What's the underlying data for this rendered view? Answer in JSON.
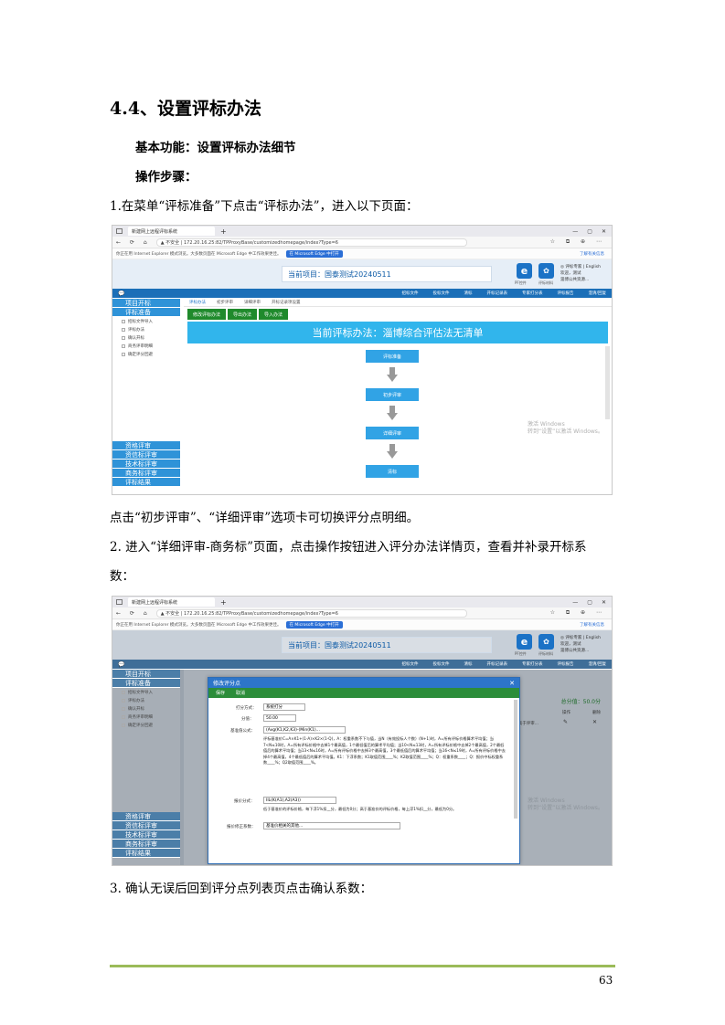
{
  "heading": "4.4、设置评标办法",
  "basic_func": "基本功能：设置评标办法细节",
  "steps_label": "操作步骤：",
  "step1": "1.在菜单“评标准备”下点击“评标办法”，进入以下页面：",
  "after_shot1": "点击“初步评审”、“详细评审”选项卡可切换评分点明细。",
  "step2_line1": "2.  进入“详细评审-商务标”页面，点击操作按钮进入评分办法详情页，查看并补录开标系",
  "step2_line2": "数：",
  "step3": "3.  确认无误后回到评分点列表页点击确认系数：",
  "page_number": "63",
  "browser": {
    "tab_title": "新建网上远程评标系统",
    "plus": "+",
    "win_buttons": [
      "—",
      "▢",
      "✕"
    ],
    "nav_glyphs": "← ⟳ ⌂",
    "url": "▲ 不安全 | 172.20.16.25:82/TPProxyBase/customizedhomepage/index?Type=6",
    "tool_glyphs": "☆ ⧉ ⊕ ⋯",
    "ie_notice": "你正在用 Internet Explorer 模式浏览。大多数页面在 Microsoft Edge 中工作效果更佳。",
    "ie_button": "在 Microsoft Edge 中打开",
    "ie_right": "了解有关信息"
  },
  "banner": {
    "project": "当前项目：国泰测试20240511",
    "e1": "e",
    "e1_caption": "PF控件",
    "e2": "✿",
    "e2_caption": "评标材料",
    "user_lines": [
      "◎ 评标专家 | English",
      "欢迎，测试",
      "淄博公共资源..."
    ]
  },
  "menu": {
    "bubble": "💬",
    "items": [
      "招标文件",
      "投标文件",
      "清标",
      "开标记录表",
      "专家打分表",
      "评标报告",
      "澄清/回复"
    ]
  },
  "sidebar": {
    "top": [
      "项目开标",
      "评标准备"
    ],
    "subs": [
      "招标文件导入",
      "评标办法",
      "确认开标",
      "商务评审明细",
      "确定评分回避"
    ],
    "bottom": [
      "资格评审",
      "资信标评审",
      "技术标评审",
      "商务标评审",
      "评标结果"
    ]
  },
  "shot1": {
    "tabs": [
      "评标办法",
      "初步评审",
      "详细评审",
      "开标记录项设置"
    ],
    "buttons": [
      "修改评标办法",
      "导出办法",
      "导入办法"
    ],
    "title": "当前评标办法：淄博综合评估法无清单",
    "flow": [
      "评标准备",
      "初步评审",
      "详细评审",
      "清标"
    ],
    "watermark": [
      "激活 Windows",
      "转到“设置”以激活 Windows。"
    ]
  },
  "shot2": {
    "dialog_title": "修改评分点",
    "dialog_buttons": [
      "保存",
      "取消"
    ],
    "close": "✕",
    "scoring_label": "打分方式：",
    "scoring_value": "系统打分",
    "score_label": "分值：",
    "score_value": "50.00",
    "formula_label": "基准值公式：",
    "formula_value": "(Avg(K1,K2,K3)-(Min(K1)...",
    "formula_text": "评标基准价C=A×K1+(1-A)×K2×(1-Q)，A：权重系数不下与值，当N（有效投标人个数）(N+1)时，A=所有评标价格算术平均值；当7<N≤10时，A=所有评标价格中去掉1个最高值，1个最低值后的算术平均值；当10<N≤13时，A=所有评标价格中去掉2个最高值，2个最低值后的算术平均值；当13<N≤16时，A=所有评标价格中去掉3个最高值，3个最低值后的算术平均值；当16<N≤19时，A=所有评标价格中去掉4个最高值，4个最低值后的算术平均值。K1：下浮系数；K1取值范围____%；K2取值范围____%；Q：权重系数____；Q：报价中标权重系数____%；Q2取值范围____%。",
    "bid_label": "报价分式：",
    "bid_value": "IIL(K(A1),A2(A3))",
    "bid_text": "低于基准价的评标价格，每下浮1%扣__分，最低为0分；高于基准价的评标价格，每上浮1%扣__分，最低为0分。",
    "bottom_label": "报价修正系数：",
    "bottom_value": "基准价相关的其他...",
    "total": "总分值：50.0分",
    "table_head": [
      "操作",
      "删除"
    ],
    "row_value": "高于评审...",
    "row_num": "1",
    "edit": "✎",
    "del": "✕",
    "watermark": [
      "激活 Windows",
      "转到“设置”以激活 Windows。"
    ]
  },
  "colors": {
    "accent_blue": "#1b6fb8",
    "title_cyan": "#31b5ec",
    "green_button": "#1f8a2c",
    "footer_line": "#9bbb59"
  }
}
